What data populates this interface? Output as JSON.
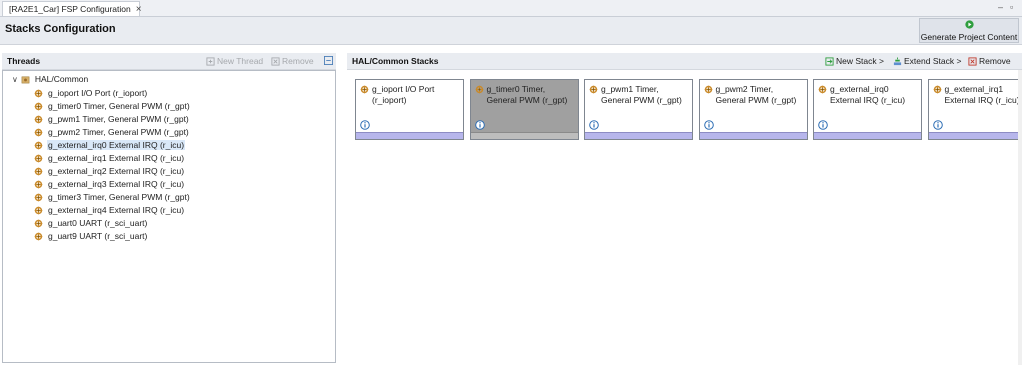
{
  "tab": {
    "title": "[RA2E1_Car] FSP Configuration",
    "close": "×"
  },
  "window": {
    "min": "–",
    "max": "▫"
  },
  "header": {
    "title": "Stacks Configuration",
    "generate_label": "Generate Project Content"
  },
  "threads": {
    "title": "Threads",
    "new_thread": "New Thread",
    "remove": "Remove",
    "root": "HAL/Common",
    "items": [
      "g_ioport I/O Port (r_ioport)",
      "g_timer0 Timer, General PWM (r_gpt)",
      "g_pwm1 Timer, General PWM (r_gpt)",
      "g_pwm2 Timer, General PWM (r_gpt)",
      "g_external_irq0 External IRQ (r_icu)",
      "g_external_irq1 External IRQ (r_icu)",
      "g_external_irq2 External IRQ (r_icu)",
      "g_external_irq3 External IRQ (r_icu)",
      "g_timer3 Timer, General PWM (r_gpt)",
      "g_external_irq4 External IRQ (r_icu)",
      "g_uart0 UART (r_sci_uart)",
      "g_uart9 UART (r_sci_uart)"
    ],
    "selected_index": 4
  },
  "stacks": {
    "title": "HAL/Common Stacks",
    "new_stack": "New Stack >",
    "extend_stack": "Extend Stack >",
    "remove": "Remove",
    "cards": [
      "g_ioport I/O Port (r_ioport)",
      "g_timer0 Timer, General PWM (r_gpt)",
      "g_pwm1 Timer, General PWM (r_gpt)",
      "g_pwm2 Timer, General PWM (r_gpt)",
      "g_external_irq0 External IRQ (r_icu)",
      "g_external_irq1 External IRQ (r_icu)"
    ],
    "selected_index": 1
  },
  "colors": {
    "accent_green": "#2e9e3e",
    "module_bar": "#b7b6ec",
    "selection": "#d9e8f8"
  }
}
